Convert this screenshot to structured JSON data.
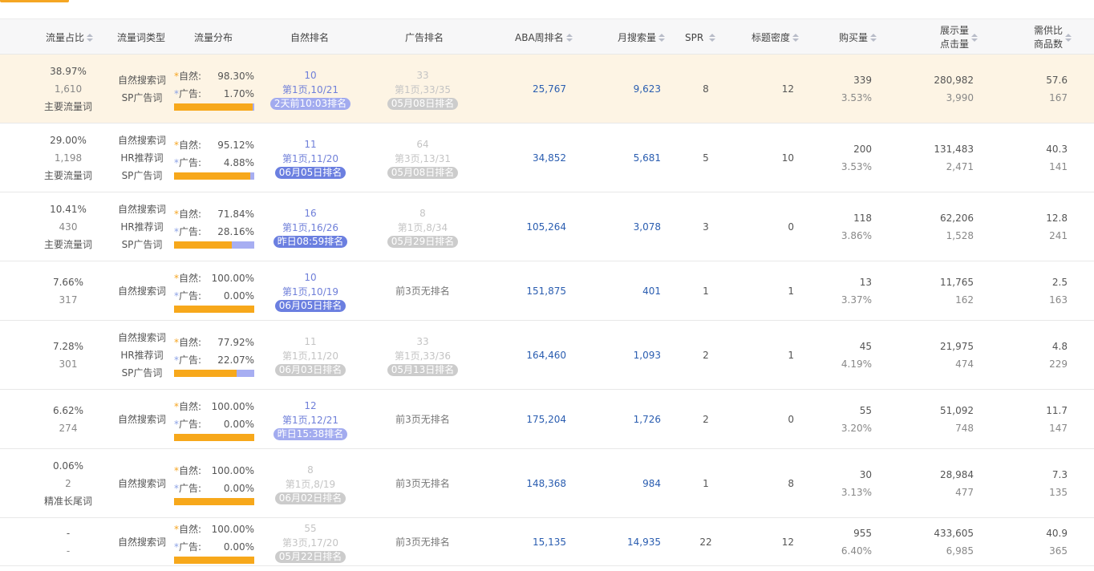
{
  "headers": {
    "share": "流量占比",
    "type": "流量词类型",
    "dist": "流量分布",
    "natural_rank": "自然排名",
    "ad_rank": "广告排名",
    "aba": "ABA周排名",
    "monthly": "月搜索量",
    "spr": "SPR",
    "title_density": "标题密度",
    "purchases": "购买量",
    "impressions_1": "展示量",
    "impressions_2": "点击量",
    "supply_1": "需供比",
    "supply_2": "商品数"
  },
  "labels": {
    "natural": "自然:",
    "ad": "广告:",
    "star": "*",
    "no_rank": "前3页无排名"
  },
  "colors": {
    "natural_bar": "#f7a81b",
    "ad_bar": "#a7aef2",
    "accent": "#f5a623",
    "link_blue": "#2a5db0"
  },
  "rows": [
    {
      "share": "38.97%",
      "count": "1,610",
      "tag": "主要流量词",
      "types": [
        "自然搜索词",
        "SP广告词"
      ],
      "nat_pct": "98.30%",
      "ad_pct": "1.70%",
      "nat_ratio": 0.983,
      "rank": "10",
      "rank_page": "第1页,10/21",
      "rank_time": "2天前10:03排名",
      "rank_style": "lblue",
      "rank_dim": false,
      "ad": "33",
      "ad_page": "第1页,33/35",
      "ad_time": "05月08日排名",
      "has_ad": true,
      "aba": "25,767",
      "monthly": "9,623",
      "spr": "8",
      "density": "12",
      "buy": "339",
      "buy_rate": "3.53%",
      "imp": "280,982",
      "clk": "3,990",
      "sd": "57.6",
      "goods": "167",
      "highlight": true
    },
    {
      "share": "29.00%",
      "count": "1,198",
      "tag": "主要流量词",
      "types": [
        "自然搜索词",
        "HR推荐词",
        "SP广告词"
      ],
      "nat_pct": "95.12%",
      "ad_pct": "4.88%",
      "nat_ratio": 0.9512,
      "rank": "11",
      "rank_page": "第1页,11/20",
      "rank_time": "06月05日排名",
      "rank_style": "blue",
      "rank_dim": false,
      "ad": "64",
      "ad_page": "第3页,13/31",
      "ad_time": "05月08日排名",
      "has_ad": true,
      "aba": "34,852",
      "monthly": "5,681",
      "spr": "5",
      "density": "10",
      "buy": "200",
      "buy_rate": "3.53%",
      "imp": "131,483",
      "clk": "2,471",
      "sd": "40.3",
      "goods": "141"
    },
    {
      "share": "10.41%",
      "count": "430",
      "tag": "主要流量词",
      "types": [
        "自然搜索词",
        "HR推荐词",
        "SP广告词"
      ],
      "nat_pct": "71.84%",
      "ad_pct": "28.16%",
      "nat_ratio": 0.7184,
      "rank": "16",
      "rank_page": "第1页,16/26",
      "rank_time": "昨日08:59排名",
      "rank_style": "blue",
      "rank_dim": false,
      "ad": "8",
      "ad_page": "第1页,8/34",
      "ad_time": "05月29日排名",
      "has_ad": true,
      "aba": "105,264",
      "monthly": "3,078",
      "spr": "3",
      "density": "0",
      "buy": "118",
      "buy_rate": "3.86%",
      "imp": "62,206",
      "clk": "1,528",
      "sd": "12.8",
      "goods": "241"
    },
    {
      "share": "7.66%",
      "count": "317",
      "tag": "",
      "types": [
        "自然搜索词"
      ],
      "nat_pct": "100.00%",
      "ad_pct": "0.00%",
      "nat_ratio": 1.0,
      "rank": "10",
      "rank_page": "第1页,10/19",
      "rank_time": "06月05日排名",
      "rank_style": "blue",
      "rank_dim": false,
      "has_ad": false,
      "aba": "151,875",
      "monthly": "401",
      "spr": "1",
      "density": "1",
      "buy": "13",
      "buy_rate": "3.37%",
      "imp": "11,765",
      "clk": "162",
      "sd": "2.5",
      "goods": "163"
    },
    {
      "share": "7.28%",
      "count": "301",
      "tag": "",
      "types": [
        "自然搜索词",
        "HR推荐词",
        "SP广告词"
      ],
      "nat_pct": "77.92%",
      "ad_pct": "22.07%",
      "nat_ratio": 0.7792,
      "rank": "11",
      "rank_page": "第1页,11/20",
      "rank_time": "06月03日排名",
      "rank_style": "grey",
      "rank_dim": true,
      "ad": "33",
      "ad_page": "第1页,33/36",
      "ad_time": "05月13日排名",
      "has_ad": true,
      "aba": "164,460",
      "monthly": "1,093",
      "spr": "2",
      "density": "1",
      "buy": "45",
      "buy_rate": "4.19%",
      "imp": "21,975",
      "clk": "474",
      "sd": "4.8",
      "goods": "229"
    },
    {
      "share": "6.62%",
      "count": "274",
      "tag": "",
      "types": [
        "自然搜索词"
      ],
      "nat_pct": "100.00%",
      "ad_pct": "0.00%",
      "nat_ratio": 1.0,
      "rank": "12",
      "rank_page": "第1页,12/21",
      "rank_time": "昨日15:38排名",
      "rank_style": "lblue",
      "rank_dim": false,
      "has_ad": false,
      "aba": "175,204",
      "monthly": "1,726",
      "spr": "2",
      "density": "0",
      "buy": "55",
      "buy_rate": "3.20%",
      "imp": "51,092",
      "clk": "748",
      "sd": "11.7",
      "goods": "147"
    },
    {
      "share": "0.06%",
      "count": "2",
      "tag": "精准长尾词",
      "types": [
        "自然搜索词"
      ],
      "nat_pct": "100.00%",
      "ad_pct": "0.00%",
      "nat_ratio": 1.0,
      "rank": "8",
      "rank_page": "第1页,8/19",
      "rank_time": "06月02日排名",
      "rank_style": "grey",
      "rank_dim": true,
      "has_ad": false,
      "aba": "148,368",
      "monthly": "984",
      "spr": "1",
      "density": "8",
      "buy": "30",
      "buy_rate": "3.13%",
      "imp": "28,984",
      "clk": "477",
      "sd": "7.3",
      "goods": "135"
    },
    {
      "share": "-",
      "count": "-",
      "tag": "",
      "types": [
        "自然搜索词"
      ],
      "nat_pct": "100.00%",
      "ad_pct": "0.00%",
      "nat_ratio": 1.0,
      "rank": "55",
      "rank_page": "第3页,17/20",
      "rank_time": "05月22日排名",
      "rank_style": "grey",
      "rank_dim": true,
      "has_ad": false,
      "aba": "15,135",
      "monthly": "14,935",
      "spr": "22",
      "density": "12",
      "buy": "955",
      "buy_rate": "6.40%",
      "imp": "433,605",
      "clk": "6,985",
      "sd": "40.9",
      "goods": "365"
    }
  ]
}
